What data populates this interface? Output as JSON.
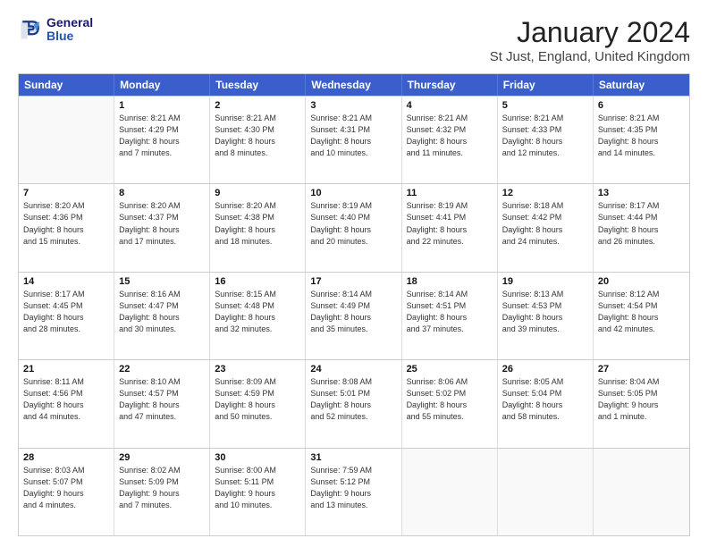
{
  "header": {
    "logo": {
      "line1": "General",
      "line2": "Blue"
    },
    "title": "January 2024",
    "subtitle": "St Just, England, United Kingdom"
  },
  "calendar": {
    "days_of_week": [
      "Sunday",
      "Monday",
      "Tuesday",
      "Wednesday",
      "Thursday",
      "Friday",
      "Saturday"
    ],
    "weeks": [
      [
        {
          "day": "",
          "empty": true
        },
        {
          "day": "1",
          "sunrise": "Sunrise: 8:21 AM",
          "sunset": "Sunset: 4:29 PM",
          "daylight": "Daylight: 8 hours and 7 minutes."
        },
        {
          "day": "2",
          "sunrise": "Sunrise: 8:21 AM",
          "sunset": "Sunset: 4:30 PM",
          "daylight": "Daylight: 8 hours and 8 minutes."
        },
        {
          "day": "3",
          "sunrise": "Sunrise: 8:21 AM",
          "sunset": "Sunset: 4:31 PM",
          "daylight": "Daylight: 8 hours and 10 minutes."
        },
        {
          "day": "4",
          "sunrise": "Sunrise: 8:21 AM",
          "sunset": "Sunset: 4:32 PM",
          "daylight": "Daylight: 8 hours and 11 minutes."
        },
        {
          "day": "5",
          "sunrise": "Sunrise: 8:21 AM",
          "sunset": "Sunset: 4:33 PM",
          "daylight": "Daylight: 8 hours and 12 minutes."
        },
        {
          "day": "6",
          "sunrise": "Sunrise: 8:21 AM",
          "sunset": "Sunset: 4:35 PM",
          "daylight": "Daylight: 8 hours and 14 minutes."
        }
      ],
      [
        {
          "day": "7",
          "sunrise": "Sunrise: 8:20 AM",
          "sunset": "Sunset: 4:36 PM",
          "daylight": "Daylight: 8 hours and 15 minutes."
        },
        {
          "day": "8",
          "sunrise": "Sunrise: 8:20 AM",
          "sunset": "Sunset: 4:37 PM",
          "daylight": "Daylight: 8 hours and 17 minutes."
        },
        {
          "day": "9",
          "sunrise": "Sunrise: 8:20 AM",
          "sunset": "Sunset: 4:38 PM",
          "daylight": "Daylight: 8 hours and 18 minutes."
        },
        {
          "day": "10",
          "sunrise": "Sunrise: 8:19 AM",
          "sunset": "Sunset: 4:40 PM",
          "daylight": "Daylight: 8 hours and 20 minutes."
        },
        {
          "day": "11",
          "sunrise": "Sunrise: 8:19 AM",
          "sunset": "Sunset: 4:41 PM",
          "daylight": "Daylight: 8 hours and 22 minutes."
        },
        {
          "day": "12",
          "sunrise": "Sunrise: 8:18 AM",
          "sunset": "Sunset: 4:42 PM",
          "daylight": "Daylight: 8 hours and 24 minutes."
        },
        {
          "day": "13",
          "sunrise": "Sunrise: 8:17 AM",
          "sunset": "Sunset: 4:44 PM",
          "daylight": "Daylight: 8 hours and 26 minutes."
        }
      ],
      [
        {
          "day": "14",
          "sunrise": "Sunrise: 8:17 AM",
          "sunset": "Sunset: 4:45 PM",
          "daylight": "Daylight: 8 hours and 28 minutes."
        },
        {
          "day": "15",
          "sunrise": "Sunrise: 8:16 AM",
          "sunset": "Sunset: 4:47 PM",
          "daylight": "Daylight: 8 hours and 30 minutes."
        },
        {
          "day": "16",
          "sunrise": "Sunrise: 8:15 AM",
          "sunset": "Sunset: 4:48 PM",
          "daylight": "Daylight: 8 hours and 32 minutes."
        },
        {
          "day": "17",
          "sunrise": "Sunrise: 8:14 AM",
          "sunset": "Sunset: 4:49 PM",
          "daylight": "Daylight: 8 hours and 35 minutes."
        },
        {
          "day": "18",
          "sunrise": "Sunrise: 8:14 AM",
          "sunset": "Sunset: 4:51 PM",
          "daylight": "Daylight: 8 hours and 37 minutes."
        },
        {
          "day": "19",
          "sunrise": "Sunrise: 8:13 AM",
          "sunset": "Sunset: 4:53 PM",
          "daylight": "Daylight: 8 hours and 39 minutes."
        },
        {
          "day": "20",
          "sunrise": "Sunrise: 8:12 AM",
          "sunset": "Sunset: 4:54 PM",
          "daylight": "Daylight: 8 hours and 42 minutes."
        }
      ],
      [
        {
          "day": "21",
          "sunrise": "Sunrise: 8:11 AM",
          "sunset": "Sunset: 4:56 PM",
          "daylight": "Daylight: 8 hours and 44 minutes."
        },
        {
          "day": "22",
          "sunrise": "Sunrise: 8:10 AM",
          "sunset": "Sunset: 4:57 PM",
          "daylight": "Daylight: 8 hours and 47 minutes."
        },
        {
          "day": "23",
          "sunrise": "Sunrise: 8:09 AM",
          "sunset": "Sunset: 4:59 PM",
          "daylight": "Daylight: 8 hours and 50 minutes."
        },
        {
          "day": "24",
          "sunrise": "Sunrise: 8:08 AM",
          "sunset": "Sunset: 5:01 PM",
          "daylight": "Daylight: 8 hours and 52 minutes."
        },
        {
          "day": "25",
          "sunrise": "Sunrise: 8:06 AM",
          "sunset": "Sunset: 5:02 PM",
          "daylight": "Daylight: 8 hours and 55 minutes."
        },
        {
          "day": "26",
          "sunrise": "Sunrise: 8:05 AM",
          "sunset": "Sunset: 5:04 PM",
          "daylight": "Daylight: 8 hours and 58 minutes."
        },
        {
          "day": "27",
          "sunrise": "Sunrise: 8:04 AM",
          "sunset": "Sunset: 5:05 PM",
          "daylight": "Daylight: 9 hours and 1 minute."
        }
      ],
      [
        {
          "day": "28",
          "sunrise": "Sunrise: 8:03 AM",
          "sunset": "Sunset: 5:07 PM",
          "daylight": "Daylight: 9 hours and 4 minutes."
        },
        {
          "day": "29",
          "sunrise": "Sunrise: 8:02 AM",
          "sunset": "Sunset: 5:09 PM",
          "daylight": "Daylight: 9 hours and 7 minutes."
        },
        {
          "day": "30",
          "sunrise": "Sunrise: 8:00 AM",
          "sunset": "Sunset: 5:11 PM",
          "daylight": "Daylight: 9 hours and 10 minutes."
        },
        {
          "day": "31",
          "sunrise": "Sunrise: 7:59 AM",
          "sunset": "Sunset: 5:12 PM",
          "daylight": "Daylight: 9 hours and 13 minutes."
        },
        {
          "day": "",
          "empty": true
        },
        {
          "day": "",
          "empty": true
        },
        {
          "day": "",
          "empty": true
        }
      ]
    ]
  }
}
